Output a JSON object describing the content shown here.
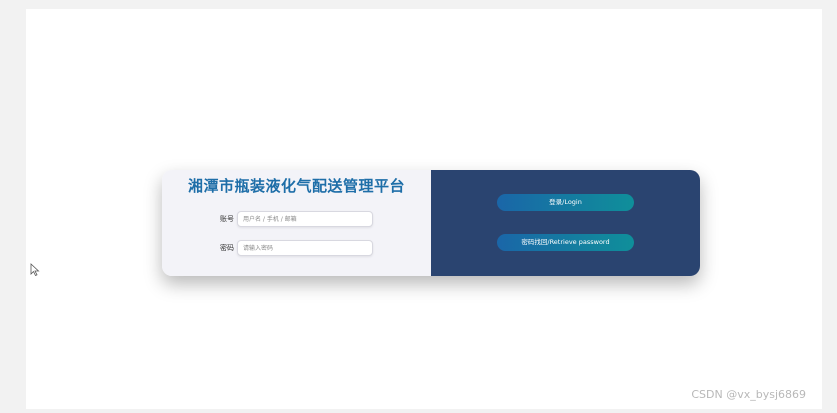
{
  "login": {
    "title": "湘潭市瓶装液化气配送管理平台",
    "account_label": "账号",
    "account_placeholder": "用户名 / 手机 / 邮箱",
    "password_label": "密码",
    "password_placeholder": "请输入密码",
    "login_button": "登录/Login",
    "retrieve_button": "密码找回/Retrieve password"
  },
  "watermark": "CSDN @vx_bysj6869",
  "colors": {
    "title": "#1e6ea8",
    "right_panel": "#2a4470",
    "button_gradient_start": "#1a66a8",
    "button_gradient_end": "#0f8f9a"
  },
  "icons": {
    "cursor": "mouse-pointer-icon"
  }
}
